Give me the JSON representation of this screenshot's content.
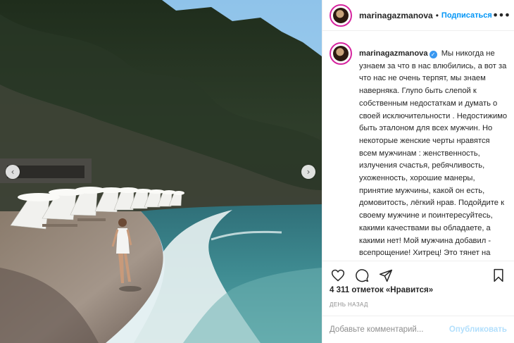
{
  "header": {
    "username": "marinagazmanova",
    "separator": "•",
    "follow_label": "Подписаться",
    "more_glyph": "•••"
  },
  "caption": {
    "username": "marinagazmanova",
    "verified_glyph": "✓",
    "text": "Мы никогда не узнаем за что в нас влюбились, а вот за что нас не очень терпят, мы знаем наверняка. Глупо быть слепой к собственным недостаткам и думать о своей исключительности . Недостижимо быть эталоном для всех мужчин. Но некоторые женские черты нравятся всем мужчинам : женственность, излучения счастья, ребячливость, ухоженность, хорошие манеры, принятие мужчины, какой он есть, домовитость, лёгкий нрав. Подойдите к своему мужчине и поинтересуйтесь, какими качествами вы обладаете, а какими нет! Мой мужчина добавил - всепрощение! Хитрец! Это тянет на божество! Но и мы претендуем не"
  },
  "photo": {
    "prev_glyph": "‹",
    "next_glyph": "›"
  },
  "actions": {
    "like_icon": "heart-icon",
    "comment_icon": "comment-icon",
    "share_icon": "share-icon",
    "save_icon": "bookmark-icon"
  },
  "likes_text": "4 311 отметок «Нравится»",
  "date_text": "ДЕНЬ НАЗАД",
  "comment": {
    "placeholder": "Добавьте комментарий...",
    "publish_label": "Опубликовать"
  },
  "colors": {
    "accent": "#0095f6",
    "publish_disabled": "#b2dffc",
    "verified": "#3897f0"
  }
}
